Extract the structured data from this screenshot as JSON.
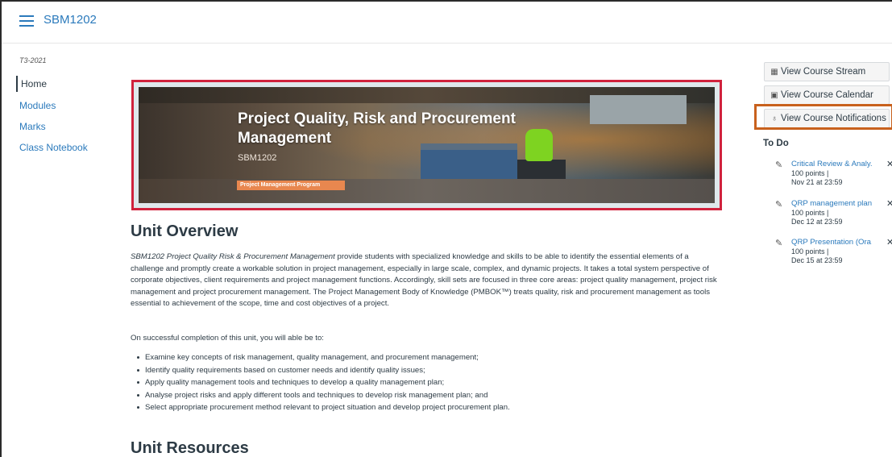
{
  "header": {
    "course_code": "SBM1202"
  },
  "nav": {
    "term": "T3-2021",
    "items": [
      {
        "label": "Home"
      },
      {
        "label": "Modules"
      },
      {
        "label": "Marks"
      },
      {
        "label": "Class Notebook"
      }
    ]
  },
  "banner": {
    "title": "Project Quality, Risk and Procurement Management",
    "code": "SBM1202",
    "tag": "Project Management Program"
  },
  "overview": {
    "heading": "Unit Overview",
    "para_italic": "SBM1202 Project Quality Risk & Procurement Management",
    "para_rest": " provide students with specialized knowledge and skills to be able to identify the essential elements of a challenge and promptly create a workable solution in project management, especially in large scale, complex, and dynamic projects. It takes a total system perspective of corporate objectives, client requirements and project management functions. Accordingly, skill sets are focused in three core areas: project quality management, project risk management and project procurement management. The Project Management Body of Knowledge (PMBOK™) treats quality, risk and procurement management as tools essential to achievement of the scope, time and cost objectives of a project.",
    "outcomes_intro": "On successful completion of this unit, you will able be  to:",
    "outcomes": [
      "Examine key concepts of risk management, quality management, and procurement management;",
      "Identify quality requirements based on customer needs and identify quality issues;",
      "Apply quality management tools and techniques to develop a quality management plan;",
      "Analyse project risks and apply different tools and techniques to develop risk management plan; and",
      "Select appropriate procurement method relevant to project situation and develop project procurement plan."
    ],
    "resources_heading": "Unit Resources"
  },
  "sidebar": {
    "buttons": [
      {
        "label": "View Course Stream",
        "icon": "stream-icon"
      },
      {
        "label": "View Course Calendar",
        "icon": "calendar-icon"
      },
      {
        "label": "View Course Notifications",
        "icon": "bell-icon"
      }
    ],
    "todo_title": "To Do",
    "todos": [
      {
        "title": "Critical Review & Analy...",
        "points": "100 points  |",
        "due": "Nov 21 at 23:59"
      },
      {
        "title": "QRP management plan...",
        "points": "100 points  |",
        "due": "Dec 12 at 23:59"
      },
      {
        "title": "QRP Presentation (Ora...",
        "points": "100 points  |",
        "due": "Dec 15 at 23:59"
      }
    ]
  },
  "colors": {
    "link": "#2b7abc",
    "banner_frame": "#d0223d",
    "notif_frame": "#c8611d",
    "tag": "#e8874f"
  }
}
